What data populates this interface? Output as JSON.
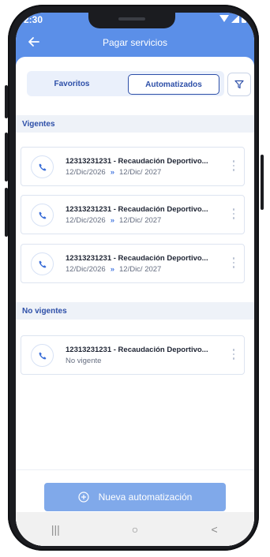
{
  "status": {
    "time": "2:30"
  },
  "header": {
    "title": "Pagar servicios"
  },
  "tabs": [
    {
      "label": "Favoritos",
      "active": false
    },
    {
      "label": "Automatizados",
      "active": true
    }
  ],
  "sections": {
    "vigentes": {
      "label": "Vigentes",
      "items": [
        {
          "name": "12313231231 - Recaudación Deportivo...",
          "start": "12/Dic/2026",
          "end": "12/Dic/ 2027"
        },
        {
          "name": "12313231231 - Recaudación Deportivo...",
          "start": "12/Dic/2026",
          "end": "12/Dic/ 2027"
        },
        {
          "name": "12313231231 - Recaudación Deportivo...",
          "start": "12/Dic/2026",
          "end": "12/Dic/ 2027"
        }
      ]
    },
    "no_vigentes": {
      "label": "No vigentes",
      "items": [
        {
          "name": "12313231231 - Recaudación Deportivo...",
          "status": "No vigente"
        }
      ]
    }
  },
  "arrows_glyph": "»",
  "cta": {
    "label": "Nueva automatización"
  },
  "nav": {
    "recents": "|||",
    "home": "○",
    "back": "<"
  },
  "colors": {
    "header": "#5b8fe8",
    "accent": "#2d4fa8",
    "cta": "#80a9ea"
  }
}
